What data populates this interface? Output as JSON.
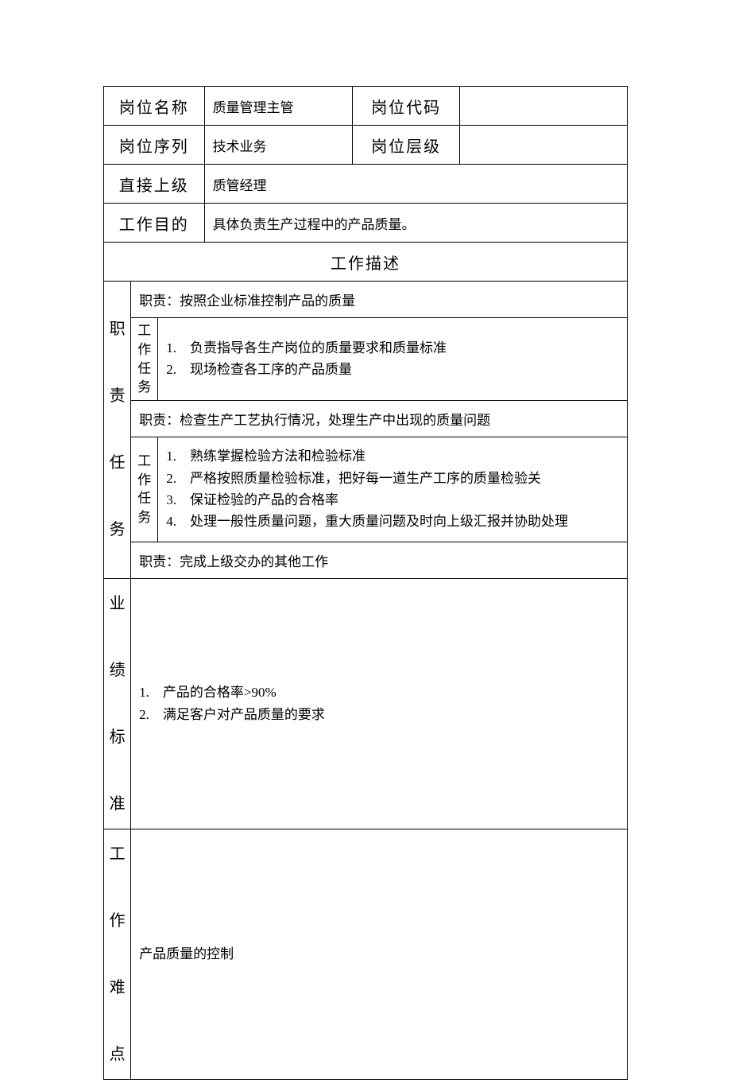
{
  "header": {
    "position_name_label": "岗位名称",
    "position_name_value": "质量管理主管",
    "position_code_label": "岗位代码",
    "position_code_value": "",
    "position_series_label": "岗位序列",
    "position_series_value": "技术业务",
    "position_level_label": "岗位层级",
    "position_level_value": "",
    "direct_superior_label": "直接上级",
    "direct_superior_value": "质管经理",
    "work_purpose_label": "工作目的",
    "work_purpose_value": "具体负责生产过程中的产品质量。"
  },
  "sections": {
    "job_description_title": "工作描述",
    "duties_label": "职\n\n责\n\n任\n\n务",
    "task_sublabel": "工\n作\n任\n务",
    "duty1_header": "职责：按照企业标准控制产品的质量",
    "duty1_tasks": [
      "1.    负责指导各生产岗位的质量要求和质量标准",
      "2.    现场检查各工序的产品质量"
    ],
    "duty2_header": "职责：检查生产工艺执行情况，处理生产中出现的质量问题",
    "duty2_tasks": [
      "1.    熟练掌握检验方法和检验标准",
      "2.    严格按照质量检验标准，把好每一道生产工序的质量检验关",
      "3.    保证检验的产品的合格率",
      "4.    处理一般性质量问题，重大质量问题及时向上级汇报并协助处理"
    ],
    "duty3_header": "职责：完成上级交办的其他工作",
    "perf_label": "业\n\n绩\n\n标\n\n准",
    "perf_items": [
      "1.    产品的合格率>90%",
      "2.    满足客户对产品质量的要求"
    ],
    "difficulty_label": "工\n\n作\n\n难\n\n点",
    "difficulty_value": "产品质量的控制"
  }
}
